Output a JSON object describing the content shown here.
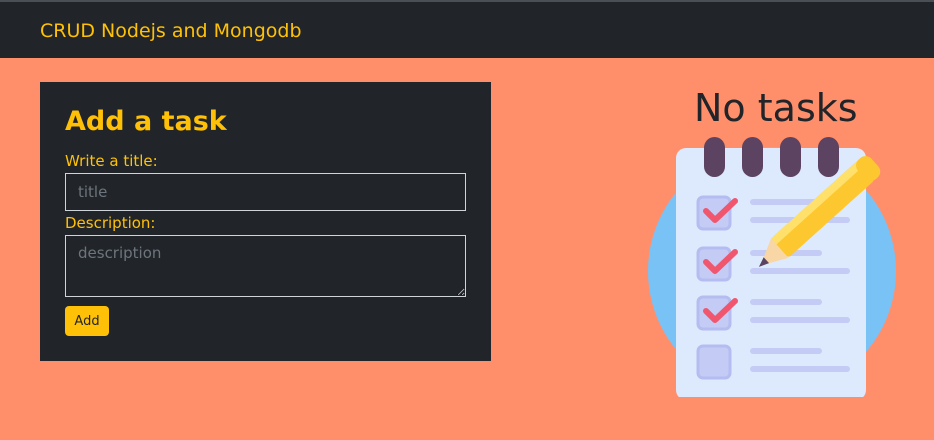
{
  "navbar": {
    "brand": "CRUD Nodejs and Mongodb"
  },
  "form": {
    "heading": "Add a task",
    "title_label": "Write a title:",
    "title_placeholder": "title",
    "title_value": "",
    "description_label": "Description:",
    "description_placeholder": "description",
    "description_value": "",
    "add_button_label": "Add"
  },
  "empty_state": {
    "heading": "No tasks",
    "image_icon": "notepad-checklist-pencil-icon"
  },
  "colors": {
    "background": "#ff8f6b",
    "dark": "#212529",
    "accent": "#ffc107"
  }
}
